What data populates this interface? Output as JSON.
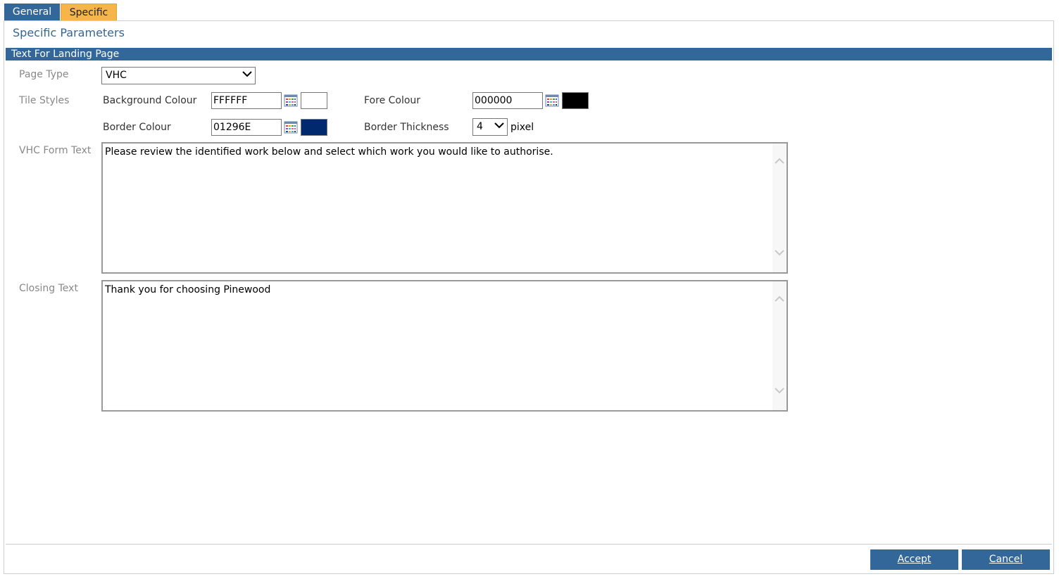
{
  "tabs": [
    {
      "label": "General"
    },
    {
      "label": "Specific"
    }
  ],
  "panel": {
    "title": "Specific Parameters",
    "section": "Text For Landing Page"
  },
  "form": {
    "page_type": {
      "label": "Page Type",
      "value": "VHC"
    },
    "tile_styles": {
      "label": "Tile Styles"
    },
    "background_colour": {
      "label": "Background Colour",
      "value": "FFFFFF",
      "swatch": "#FFFFFF"
    },
    "fore_colour": {
      "label": "Fore Colour",
      "value": "000000",
      "swatch": "#000000"
    },
    "border_colour": {
      "label": "Border Colour",
      "value": "01296E",
      "swatch": "#01296E"
    },
    "border_thickness": {
      "label": "Border Thickness",
      "value": "4",
      "unit": "pixel"
    },
    "vhc_form_text": {
      "label": "VHC Form Text",
      "value": "Please review the identified work below and select which work you would like to authorise."
    },
    "closing_text": {
      "label": "Closing Text",
      "value": "Thank you for choosing Pinewood"
    }
  },
  "buttons": {
    "accept": "Accept",
    "cancel": "Cancel"
  },
  "icons": {
    "colour_picker": "palette-icon",
    "dropdown": "chevron-down-icon",
    "scroll_up": "chevron-up-icon",
    "scroll_down": "chevron-down-icon"
  },
  "colors": {
    "accent": "#336699",
    "active_tab": "#F5B54A"
  }
}
